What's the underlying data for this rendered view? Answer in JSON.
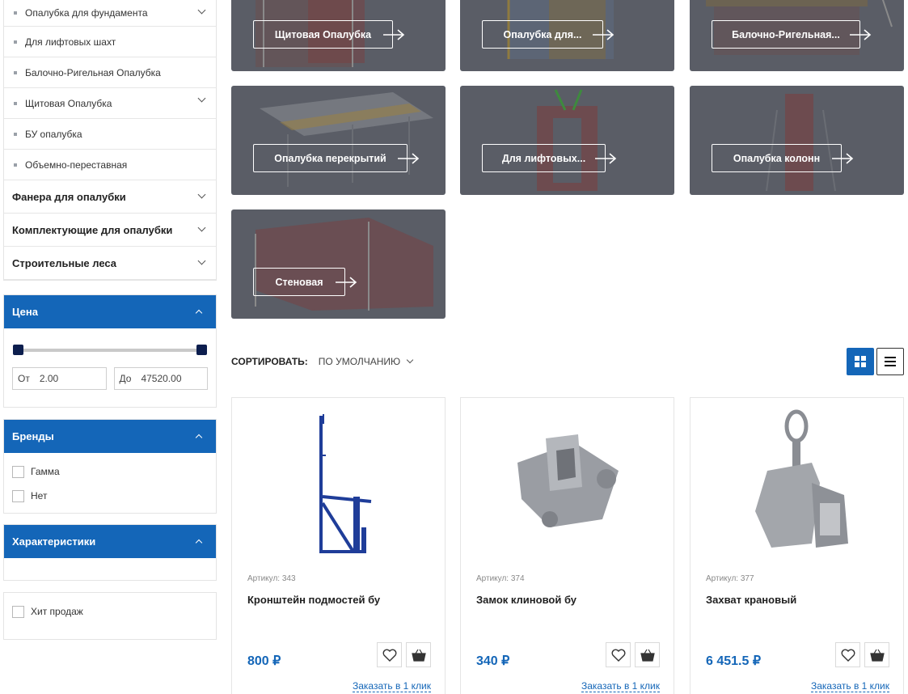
{
  "sidebar": {
    "subcategories": [
      "Опалубка для фундамента",
      "Для лифтовых шахт",
      "Балочно-Ригельная Опалубка",
      "Щитовая Опалубка",
      "БУ опалубка",
      "Объемно-переставная"
    ],
    "categories": [
      "Фанера для опалубки",
      "Комплектующие для опалубки",
      "Строительные леса"
    ]
  },
  "filters": {
    "price": {
      "title": "Цена",
      "from_label": "От",
      "from_value": "2.00",
      "to_label": "До",
      "to_value": "47520.00"
    },
    "brands": {
      "title": "Бренды",
      "options": [
        "Гамма",
        "Нет"
      ]
    },
    "characteristics": {
      "title": "Характеристики"
    },
    "bestseller": {
      "label": "Хит продаж"
    }
  },
  "tiles": [
    "Щитовая Опалубка",
    "Опалубка для...",
    "Балочно-Ригельная...",
    "Опалубка перекрытий",
    "Для лифтовых...",
    "Опалубка колонн",
    "Стеновая"
  ],
  "sort": {
    "label": "СОРТИРОВАТЬ:",
    "value": "ПО УМОЛЧАНИЮ"
  },
  "products": [
    {
      "article": "Артикул: 343",
      "name": "Кронштейн подмостей бу",
      "price": "800 ₽",
      "order_link": "Заказать в 1 клик"
    },
    {
      "article": "Артикул: 374",
      "name": "Замок клиновой бу",
      "price": "340 ₽",
      "order_link": "Заказать в 1 клик"
    },
    {
      "article": "Артикул: 377",
      "name": "Захват крановый",
      "price": "6 451.5 ₽",
      "order_link": "Заказать в 1 клик"
    }
  ],
  "colors": {
    "accent": "#1466b8",
    "tile_overlay": "#5a5d66",
    "slider_handle": "#0c1e4e"
  },
  "icons": [
    "chevron-down-icon",
    "chevron-up-icon",
    "arrow-right-icon",
    "grid-view-icon",
    "list-view-icon",
    "heart-icon",
    "basket-icon"
  ]
}
